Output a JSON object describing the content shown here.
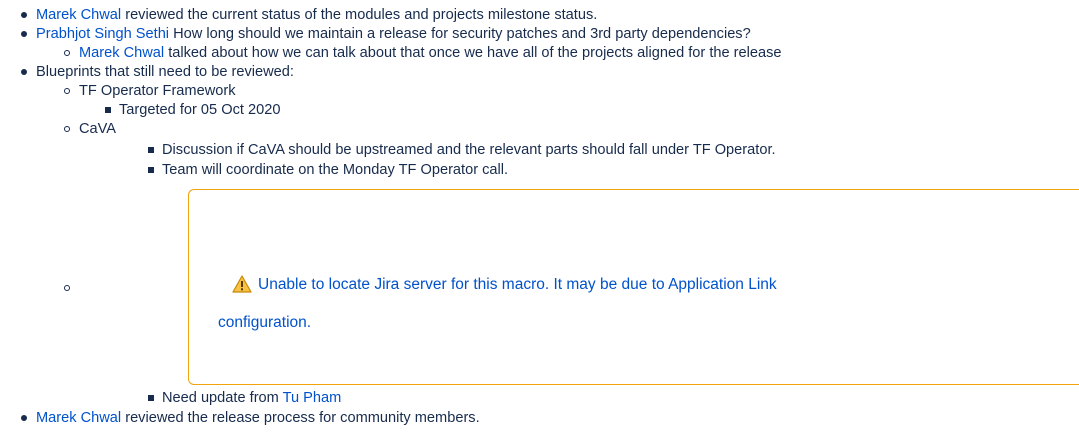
{
  "notes": {
    "item1": {
      "person": "Marek Chwal",
      "text": " reviewed the current status of the modules and projects milestone status."
    },
    "item2": {
      "person": "Prabhjot Singh Sethi",
      "text": " How long should we maintain a release for security patches and 3rd party dependencies?",
      "sub": {
        "person": "Marek Chwal",
        "text": " talked about how we can talk about that once we have all of the projects aligned for the release"
      }
    },
    "item3": {
      "text": "Blueprints that still need to be reviewed:",
      "tf_operator": {
        "label": "TF Operator Framework",
        "target": "Targeted for 05 Oct 2020"
      },
      "cava": {
        "label": "CaVA",
        "discussion": "Discussion if CaVA should be upstreamed and the relevant parts should fall under TF Operator.",
        "coordinate": "Team will coordinate on the Monday TF Operator call."
      },
      "jira_macro": {
        "message_line1": "Unable to locate Jira server for this macro. It may be due to Application Link",
        "message_line2": "configuration.",
        "icon": "warning-icon",
        "border_color": "#f0a30a"
      },
      "update": {
        "text": "Need update from ",
        "person": "Tu Pham"
      }
    },
    "item4": {
      "person": "Marek Chwal",
      "text": " reviewed the release process for community members."
    }
  },
  "colors": {
    "link": "#0052cc",
    "text": "#172b4d",
    "warning": "#f0a30a"
  }
}
